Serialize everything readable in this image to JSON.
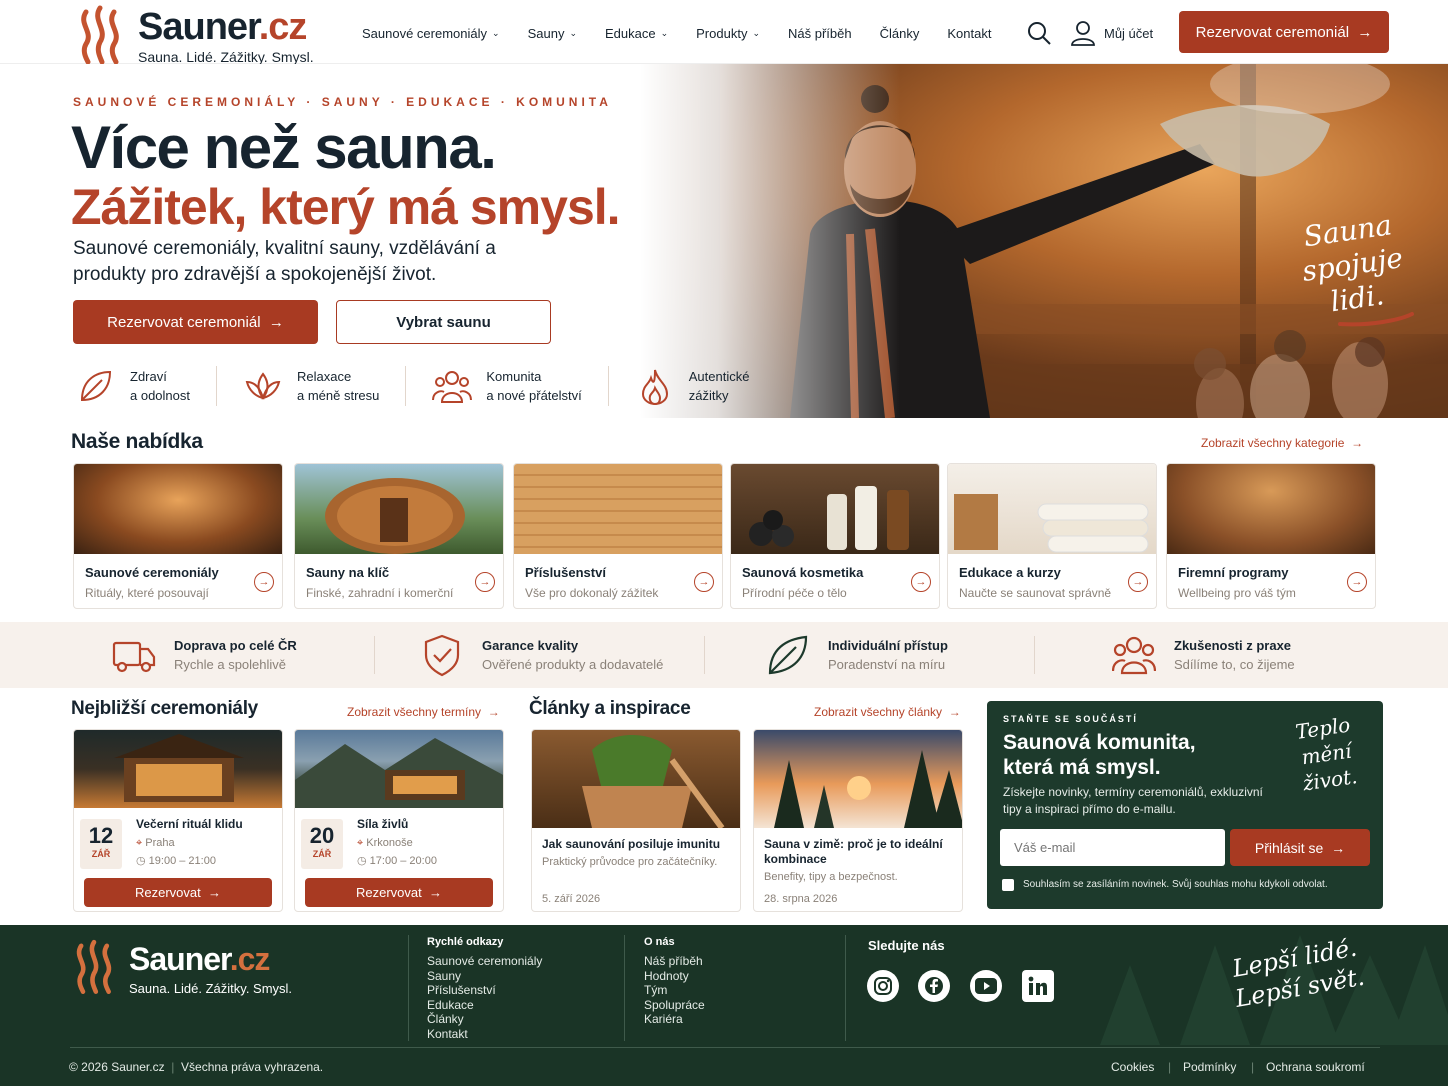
{
  "brand": {
    "name": "Sauner",
    "tld": ".cz",
    "tagline": "Sauna. Lidé. Zážitky. Smysl."
  },
  "nav": [
    "Saunové ceremoniály",
    "Sauny",
    "Edukace",
    "Produkty",
    "Náš příběh",
    "Články",
    "Kontakt"
  ],
  "header": {
    "account": "Můj účet",
    "cta": "Rezervovat ceremoniál",
    "cta_arrow": "→"
  },
  "hero": {
    "eyebrow": "SAUNOVÉ CEREMONIÁLY · SAUNY · EDUKACE · KOMUNITA",
    "title": "Více než sauna.",
    "title2": "Zážitek, který má smysl.",
    "subtitle": "Saunové ceremoniály, kvalitní sauny, vzdělávání a produkty pro zdravější a spokojenější život.",
    "cta_primary": "Rezervovat ceremoniál",
    "cta_secondary": "Vybrat saunu",
    "script_line1": "Sauna",
    "script_line2": "spojuje",
    "script_line3": "lidi.",
    "benefits": [
      {
        "icon": "leaf-icon",
        "line1": "Zdraví",
        "line2": "a odolnost"
      },
      {
        "icon": "lotus-icon",
        "line1": "Relaxace",
        "line2": "a méně stresu"
      },
      {
        "icon": "people-icon",
        "line1": "Komunita",
        "line2": "a nové přátelství"
      },
      {
        "icon": "flame-icon",
        "line1": "Autentické",
        "line2": "zážitky"
      }
    ]
  },
  "offer": {
    "title": "Naše nabídka",
    "link": "Zobrazit všechny kategorie",
    "cards": [
      {
        "title": "Saunové ceremoniály",
        "sub": "Rituály, které posouvají"
      },
      {
        "title": "Sauny na klíč",
        "sub": "Finské, zahradní i komerční"
      },
      {
        "title": "Příslušenství",
        "sub": "Vše pro dokonalý zážitek"
      },
      {
        "title": "Saunová kosmetika",
        "sub": "Přírodní péče o tělo"
      },
      {
        "title": "Edukace a kurzy",
        "sub": "Naučte se saunovat správně"
      },
      {
        "title": "Firemní programy",
        "sub": "Wellbeing pro váš tým"
      }
    ]
  },
  "features": [
    {
      "icon": "truck-icon",
      "title": "Doprava po celé ČR",
      "sub": "Rychle a spolehlivě"
    },
    {
      "icon": "shield-check-icon",
      "title": "Garance kvality",
      "sub": "Ověřené produkty a dodavatelé"
    },
    {
      "icon": "leaf-icon",
      "title": "Individuální přístup",
      "sub": "Poradenství na míru"
    },
    {
      "icon": "people-icon",
      "title": "Zkušenosti z praxe",
      "sub": "Sdílíme to, co žijeme"
    }
  ],
  "events": {
    "title": "Nejbližší ceremoniály",
    "link": "Zobrazit všechny termíny",
    "items": [
      {
        "day": "12",
        "month": "ZÁŘ",
        "title": "Večerní rituál klidu",
        "place": "Praha",
        "time": "19:00 – 21:00",
        "cta": "Rezervovat"
      },
      {
        "day": "20",
        "month": "ZÁŘ",
        "title": "Síla živlů",
        "place": "Krkonoše",
        "time": "17:00 – 20:00",
        "cta": "Rezervovat"
      }
    ]
  },
  "articles": {
    "title": "Články a inspirace",
    "link": "Zobrazit všechny články",
    "items": [
      {
        "title": "Jak saunování posiluje imunitu",
        "sub": "Praktický průvodce pro začátečníky.",
        "date": "5. září 2026"
      },
      {
        "title": "Sauna v zimě: proč je to ideální kombinace",
        "sub": "Benefity, tipy a bezpečnost.",
        "date": "28. srpna 2026"
      }
    ]
  },
  "newsletter": {
    "eyebrow": "STAŇTE SE SOUČÁSTÍ",
    "title_line1": "Saunová komunita,",
    "title_line2": "která má smysl.",
    "text": "Získejte novinky, termíny ceremoniálů, exkluzivní tipy a inspiraci přímo do e-mailu.",
    "placeholder": "Váš e-mail",
    "button": "Přihlásit se",
    "consent": "Souhlasím se zasíláním novinek. Svůj souhlas mohu kdykoli odvolat.",
    "script_line1": "Teplo",
    "script_line2": "mění",
    "script_line3": "život."
  },
  "footer": {
    "quick_title": "Rychlé odkazy",
    "quick": [
      "Saunové ceremoniály",
      "Sauny",
      "Příslušenství",
      "Edukace",
      "Články",
      "Kontakt"
    ],
    "about_title": "O nás",
    "about": [
      "Náš příběh",
      "Hodnoty",
      "Tým",
      "Spolupráce",
      "Kariéra"
    ],
    "social_title": "Sledujte nás",
    "social": [
      "instagram-icon",
      "facebook-icon",
      "youtube-icon",
      "linkedin-icon"
    ],
    "script_line1": "Lepší lidé.",
    "script_line2": "Lepší svět.",
    "copyright": "© 2026 Sauner.cz",
    "rights": "Všechna práva vyhrazena.",
    "legal": [
      "Cookies",
      "Podmínky",
      "Ochrana soukromí"
    ]
  },
  "colors": {
    "accent": "#a83a22",
    "dark": "#17242f",
    "green": "#1d3a2c"
  }
}
